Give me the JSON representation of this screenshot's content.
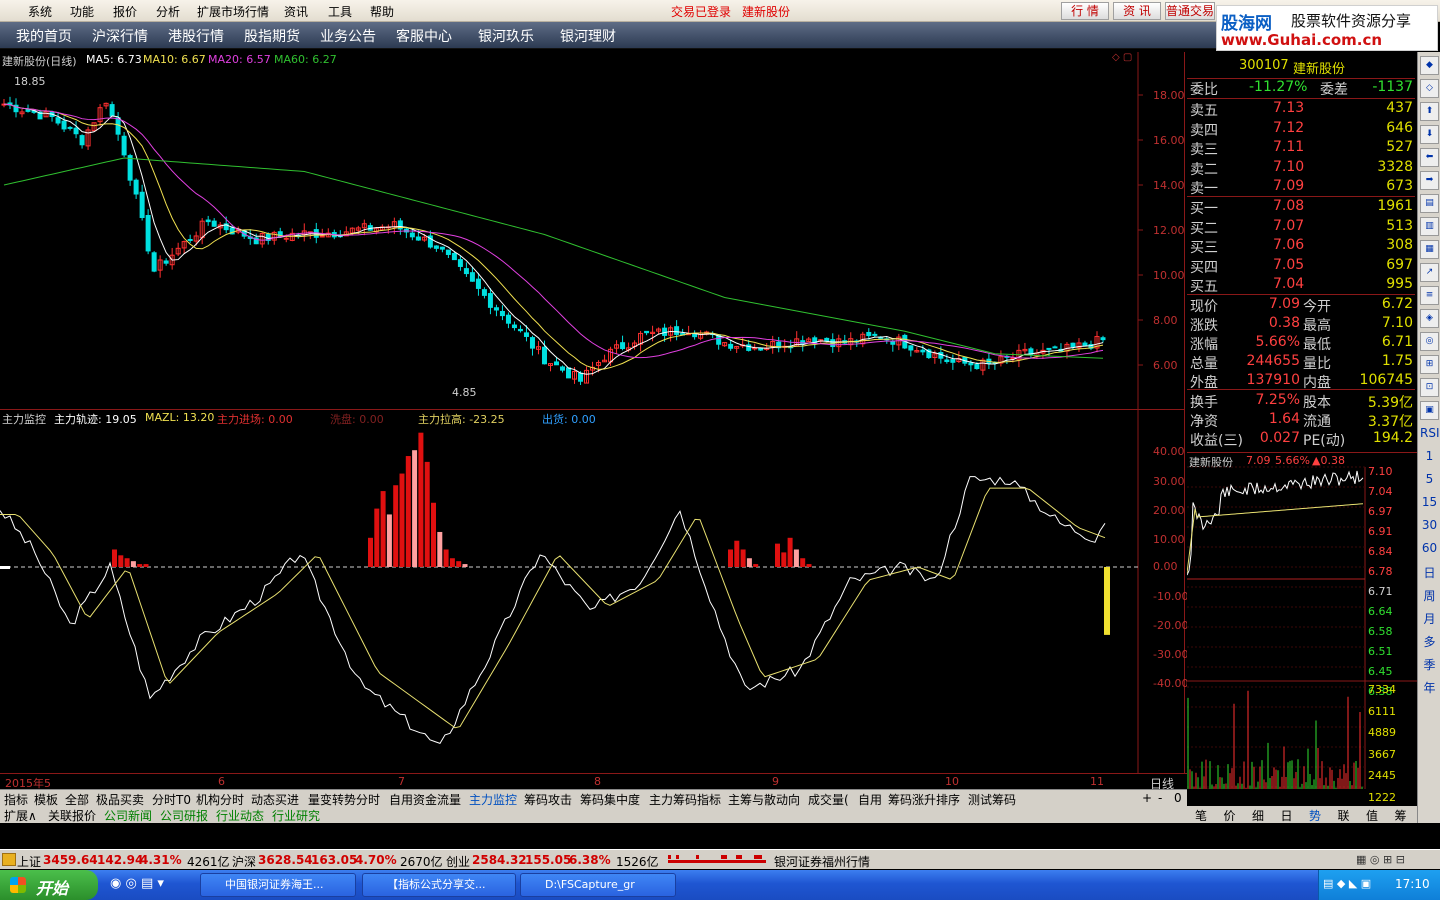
{
  "menu": {
    "items": [
      "系统",
      "功能",
      "报价",
      "分析",
      "扩展市场行情",
      "资讯",
      "工具",
      "帮助"
    ],
    "login_status": "交易已登录",
    "stock_name": "建新股份",
    "btn_quote": "行 情",
    "btn_news": "资 讯",
    "btn_normal_trade": "普通交易"
  },
  "logo": {
    "line1": "股海网",
    "line1b": "股票软件资源分享",
    "line2": "www.Guhai.com.cn"
  },
  "nav": {
    "items": [
      "我的首页",
      "沪深行情",
      "港股行情",
      "股指期货",
      "业务公告",
      "客服中心",
      "银河玖乐",
      "银河理财"
    ]
  },
  "kline": {
    "title": "建新股份(日线)",
    "ma5": "MA5: 6.73",
    "ma10": "MA10: 6.67",
    "ma20": "MA20: 6.57",
    "ma60": "MA60: 6.27",
    "high_label": "18.85",
    "low_label": "4.85",
    "y_ticks": [
      "18.00",
      "16.00",
      "14.00",
      "12.00",
      "10.00",
      "8.00",
      "6.00"
    ],
    "colors": {
      "ma5": "#ffffff",
      "ma10": "#f0e050",
      "ma20": "#e040e0",
      "ma60": "#30c030",
      "up": "#ff3030",
      "down": "#00e0e0"
    }
  },
  "indicator": {
    "name": "主力监控",
    "track": "主力轨迹: 19.05",
    "mazl": "MAZL: 13.20",
    "enter": "主力进场: 0.00",
    "wash": "洗盘: 0.00",
    "pull": "主力拉高: -23.25",
    "sell": "出货: 0.00",
    "y_ticks": [
      "40.00",
      "30.00",
      "20.00",
      "10.00",
      "0.00",
      "-10.00",
      "-20.00",
      "-30.00",
      "-40.00"
    ]
  },
  "date_axis": {
    "labels": [
      "2015年5",
      "6",
      "7",
      "8",
      "9",
      "10",
      "11"
    ],
    "period": "日线"
  },
  "quote": {
    "code": "300107",
    "name": "建新股份",
    "weibi_label": "委比",
    "weibi": "-11.27%",
    "weicha_label": "委差",
    "weicha": "-1137",
    "sells": [
      {
        "label": "卖五",
        "price": "7.13",
        "vol": "437"
      },
      {
        "label": "卖四",
        "price": "7.12",
        "vol": "646"
      },
      {
        "label": "卖三",
        "price": "7.11",
        "vol": "527"
      },
      {
        "label": "卖二",
        "price": "7.10",
        "vol": "3328"
      },
      {
        "label": "卖一",
        "price": "7.09",
        "vol": "673"
      }
    ],
    "buys": [
      {
        "label": "买一",
        "price": "7.08",
        "vol": "1961"
      },
      {
        "label": "买二",
        "price": "7.07",
        "vol": "513"
      },
      {
        "label": "买三",
        "price": "7.06",
        "vol": "308"
      },
      {
        "label": "买四",
        "price": "7.05",
        "vol": "697"
      },
      {
        "label": "买五",
        "price": "7.04",
        "vol": "995"
      }
    ],
    "stats": [
      {
        "l1": "现价",
        "v1": "7.09",
        "l2": "今开",
        "v2": "6.72"
      },
      {
        "l1": "涨跌",
        "v1": "0.38",
        "l2": "最高",
        "v2": "7.10"
      },
      {
        "l1": "涨幅",
        "v1": "5.66%",
        "l2": "最低",
        "v2": "6.71"
      },
      {
        "l1": "总量",
        "v1": "244655",
        "l2": "量比",
        "v2": "1.75"
      },
      {
        "l1": "外盘",
        "v1": "137910",
        "l2": "内盘",
        "v2": "106745"
      }
    ],
    "stats2": [
      {
        "l1": "换手",
        "v1": "7.25%",
        "l2": "股本",
        "v2": "5.39亿"
      },
      {
        "l1": "净资",
        "v1": "1.64",
        "l2": "流通",
        "v2": "3.37亿"
      },
      {
        "l1": "收益(三)",
        "v1": "0.027",
        "l2": "PE(动)",
        "v2": "194.2"
      }
    ]
  },
  "minichart": {
    "name": "建新股份",
    "price": "7.09",
    "pct": "5.66%",
    "change": "▲0.38",
    "price_ticks": [
      "7.10",
      "7.04",
      "6.97",
      "6.91",
      "6.84",
      "6.78",
      "6.71",
      "6.64",
      "6.58",
      "6.51",
      "6.45",
      "6.38"
    ],
    "vol_ticks": [
      "7334",
      "6111",
      "4889",
      "3667",
      "2445",
      "1222"
    ]
  },
  "right_toolbar": {
    "labels": [
      "RSI",
      "1",
      "5",
      "15",
      "30",
      "60",
      "日",
      "周",
      "月",
      "多",
      "季",
      "年"
    ]
  },
  "tabs_row1": [
    "指标",
    "模板",
    "全部",
    "极品买卖",
    "分时T0",
    "机构分时",
    "动态买进",
    "量变转势分时",
    "自用资金流量",
    "主力监控",
    "筹码攻击",
    "筹码集中度",
    "主力筹码指标",
    "主筹与散动向",
    "成交量(",
    "自用",
    "筹码涨升排序",
    "测试筹码"
  ],
  "tabs_row1_active": "主力监控",
  "tabs_row1_ctrl": [
    "+",
    "-",
    "0"
  ],
  "tabs_row2": [
    "扩展∧",
    "关联报价",
    "公司新闻",
    "公司研报",
    "行业动态",
    "行业研究"
  ],
  "bottom_tabs": [
    "笔",
    "价",
    "细",
    "日",
    "势",
    "联",
    "值",
    "筹"
  ],
  "statusbar": {
    "sh_label": "上证",
    "sh_val": "3459.64",
    "sh_chg": "142.94",
    "sh_pct": "4.31%",
    "sh_amt": "4261亿",
    "sz_label": "沪深",
    "sz_val": "3628.54",
    "sz_chg": "163.05",
    "sz_pct": "4.70%",
    "sz_amt": "2670亿",
    "cy_label": "创业",
    "cy_val": "2584.32",
    "cy_chg": "155.05",
    "cy_pct": "6.38%",
    "cy_amt": "1526亿",
    "broker": "银河证券福州行情"
  },
  "taskbar": {
    "start": "开始",
    "tasks": [
      "中国银河证券海王...",
      "【指标公式分享交...",
      "D:\\FSCapture_gr"
    ],
    "clock": "17:10"
  }
}
